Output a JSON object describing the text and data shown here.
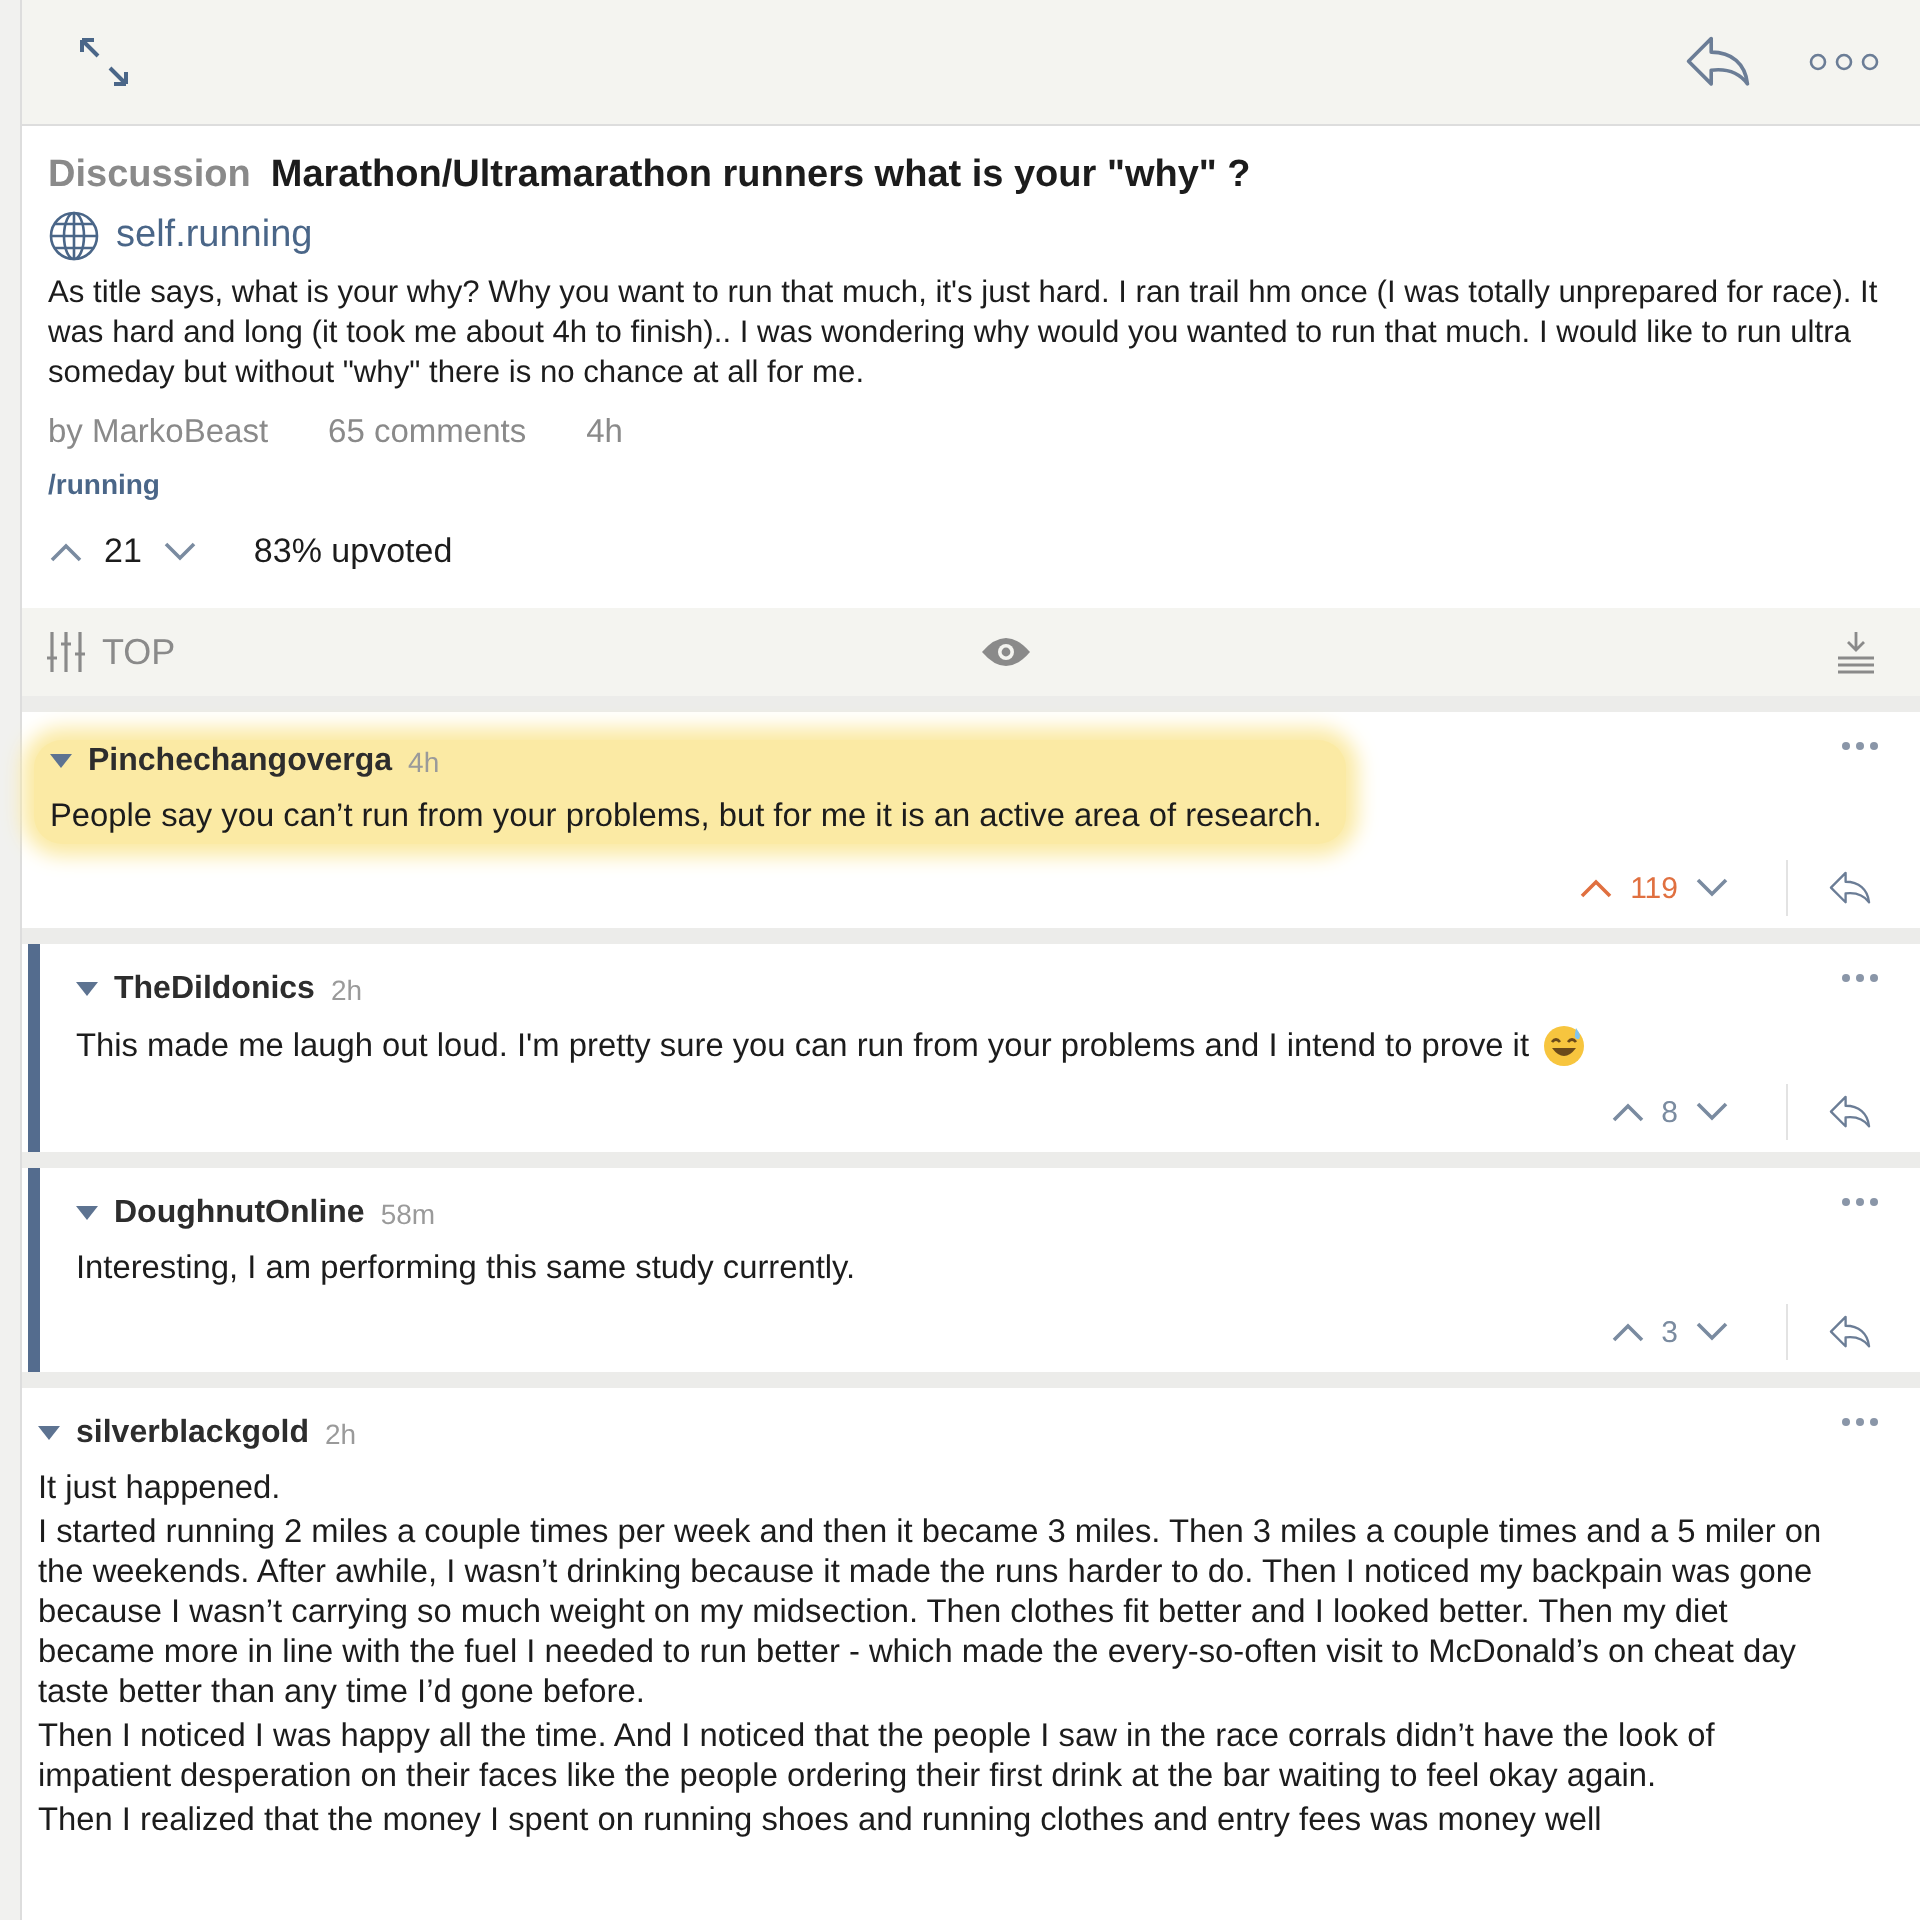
{
  "post": {
    "flair": "Discussion",
    "title": "Marathon/Ultramarathon runners what is your \"why\" ?",
    "domain": "self.running",
    "body": "As title says, what is your why? Why you want to run that much, it's just hard. I ran trail hm once (I was totally unprepared for race). It was hard and long (it took me about 4h to finish).. I was wondering why would you wanted to run that much. I would like to run ultra someday but without \"why\" there is no chance at all for me.",
    "author": "by MarkoBeast",
    "comments_count": "65 comments",
    "age": "4h",
    "subreddit": "/running",
    "score": "21",
    "upvoted_pct": "83% upvoted"
  },
  "sort": {
    "label": "TOP"
  },
  "comments": [
    {
      "author": "Pinchechangoverga",
      "age": "4h",
      "highlighted": true,
      "upvoted": true,
      "score": "119",
      "paragraphs": [
        "People say you can’t run from your problems, but for me it is an active area of research."
      ],
      "children": [
        {
          "author": "TheDildonics",
          "age": "2h",
          "highlighted": false,
          "upvoted": false,
          "score": "8",
          "paragraphs": [
            "This made me laugh out loud. I'm pretty sure you can run from your problems and I intend to prove it"
          ],
          "emoji": true
        },
        {
          "author": "DoughnutOnline",
          "age": "58m",
          "highlighted": false,
          "upvoted": false,
          "score": "3",
          "paragraphs": [
            "Interesting, I am performing this same study currently."
          ]
        }
      ]
    },
    {
      "author": "silverblackgold",
      "age": "2h",
      "highlighted": false,
      "paragraphs": [
        "It just happened.",
        "I started running 2 miles a couple times per week and then it became 3 miles. Then 3 miles a couple times and a 5 miler on the weekends. After awhile, I wasn’t drinking because it made the runs harder to do. Then I noticed my backpain was gone because I wasn’t carrying so much weight on my midsection. Then clothes fit better and I looked better. Then my diet became more in line with the fuel I needed to run better - which made the every-so-often visit to McDonald’s on cheat day taste better than any time I’d gone before.",
        "Then I noticed I was happy all the time. And I noticed that the people I saw in the race corrals didn’t have the look of impatient desperation on their faces like the people ordering their first drink at the bar waiting to feel okay again.",
        "Then I realized that the money I spent on running shoes and running clothes and entry fees was money well"
      ]
    }
  ]
}
